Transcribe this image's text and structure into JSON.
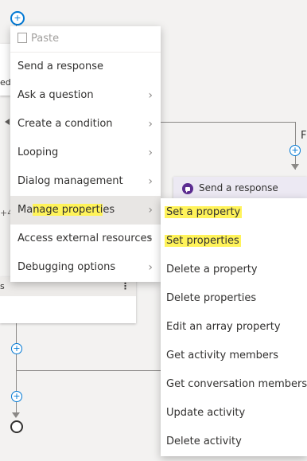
{
  "flow": {
    "fragment_left_top": "ed",
    "fragment_left_mid": "+4",
    "fragment_left_lower": "s",
    "fragment_right": "F",
    "card_more_glyph": "⋮",
    "send_response_card_title": "Send a response",
    "plus_glyph": "+"
  },
  "context_menu": {
    "paste_label": "Paste",
    "items": [
      {
        "label": "Send a response",
        "has_submenu": false
      },
      {
        "label": "Ask a question",
        "has_submenu": true
      },
      {
        "label": "Create a condition",
        "has_submenu": true
      },
      {
        "label": "Looping",
        "has_submenu": true
      },
      {
        "label": "Dialog management",
        "has_submenu": true
      },
      {
        "label_pre": "Ma",
        "label_hl": "nage properti",
        "label_post": "es",
        "has_submenu": true
      },
      {
        "label": "Access external resources",
        "has_submenu": true
      },
      {
        "label": "Debugging options",
        "has_submenu": true
      }
    ],
    "chevron": "›"
  },
  "submenu": {
    "items": [
      {
        "label": "Set a property",
        "highlighted": true
      },
      {
        "label": "Set properties",
        "highlighted": true
      },
      {
        "label": "Delete a property"
      },
      {
        "label": "Delete properties"
      },
      {
        "label": "Edit an array property"
      },
      {
        "label": "Get activity members"
      },
      {
        "label": "Get conversation members"
      },
      {
        "label": "Update activity"
      },
      {
        "label": "Delete activity"
      }
    ]
  },
  "colors": {
    "accent": "#0078d4",
    "highlight": "#fff35a",
    "card_icon": "#5c2d91"
  }
}
